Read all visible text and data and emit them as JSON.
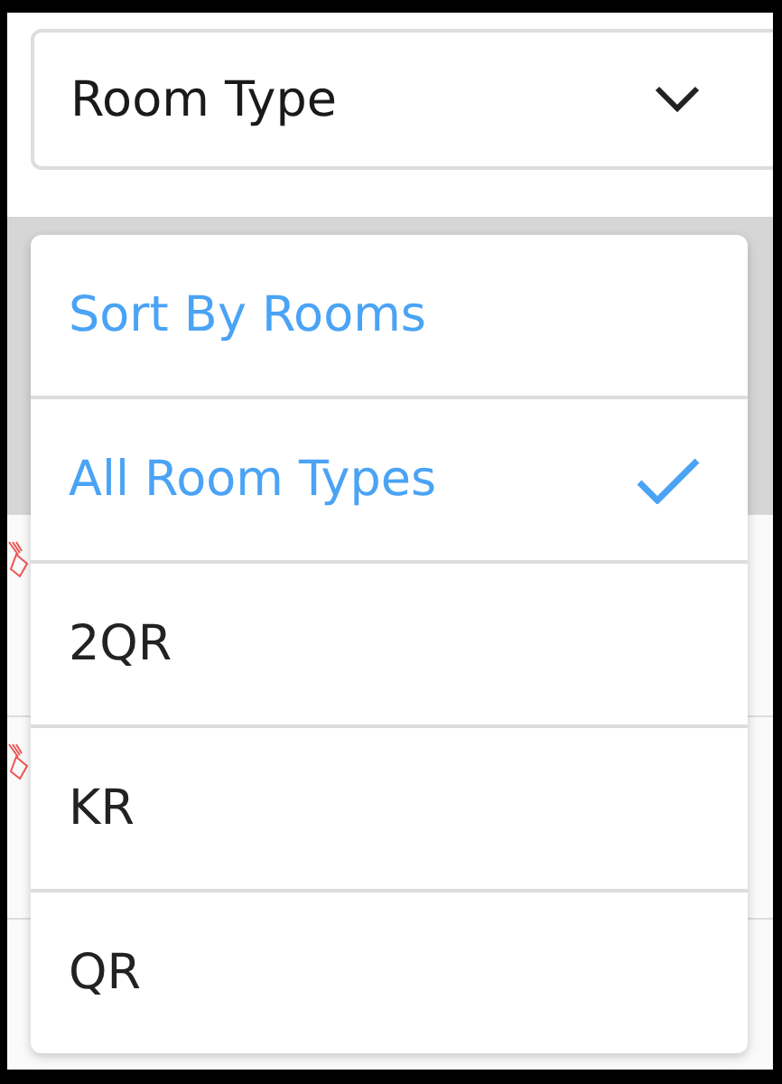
{
  "select": {
    "value": "Room Type"
  },
  "background_rows": [
    {
      "kind": "broom"
    },
    {
      "kind": "broom"
    },
    {
      "kind": "plain"
    }
  ],
  "menu": {
    "items": [
      {
        "label": "Sort By Rooms",
        "kind": "header"
      },
      {
        "label": "All Room Types",
        "kind": "option",
        "selected": true
      },
      {
        "label": "2QR",
        "kind": "option",
        "selected": false
      },
      {
        "label": "KR",
        "kind": "option",
        "selected": false
      },
      {
        "label": "QR",
        "kind": "option",
        "selected": false
      }
    ]
  }
}
